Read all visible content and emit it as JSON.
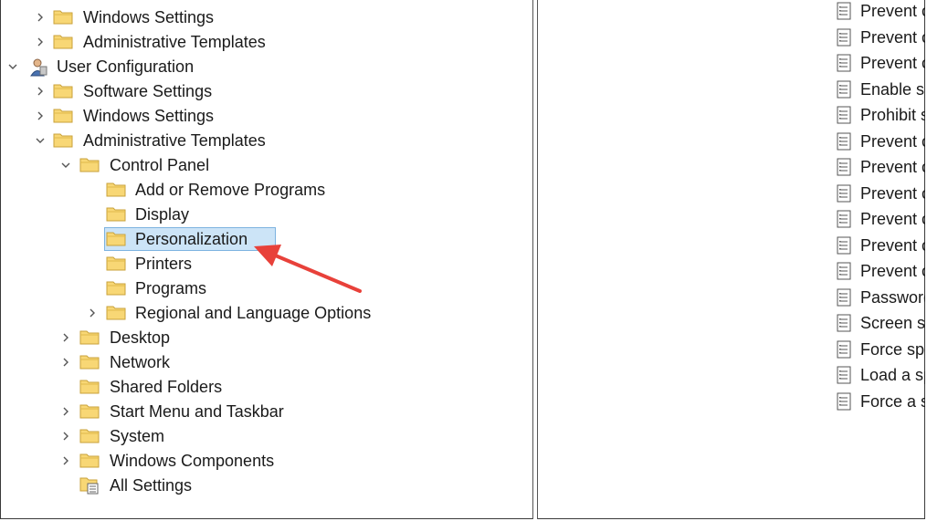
{
  "tree": [
    {
      "label": "Windows Settings",
      "expand": "collapsed",
      "icon": "folder-icon"
    },
    {
      "label": "Administrative Templates",
      "expand": "collapsed",
      "icon": "folder-icon"
    },
    {
      "label": "User Configuration",
      "expand": "expanded",
      "icon": "user-config-icon"
    },
    {
      "label": "Software Settings",
      "expand": "collapsed",
      "icon": "folder-icon"
    },
    {
      "label": "Windows Settings",
      "expand": "collapsed",
      "icon": "folder-icon"
    },
    {
      "label": "Administrative Templates",
      "expand": "expanded",
      "icon": "folder-icon"
    },
    {
      "label": "Control Panel",
      "expand": "expanded",
      "icon": "folder-icon"
    },
    {
      "label": "Add or Remove Programs",
      "expand": "none",
      "icon": "folder-icon"
    },
    {
      "label": "Display",
      "expand": "none",
      "icon": "folder-icon"
    },
    {
      "label": "Personalization",
      "expand": "none",
      "icon": "folder-icon",
      "selected": true
    },
    {
      "label": "Printers",
      "expand": "none",
      "icon": "folder-icon"
    },
    {
      "label": "Programs",
      "expand": "none",
      "icon": "folder-icon"
    },
    {
      "label": "Regional and Language Options",
      "expand": "collapsed",
      "icon": "folder-icon"
    },
    {
      "label": "Desktop",
      "expand": "collapsed",
      "icon": "folder-icon"
    },
    {
      "label": "Network",
      "expand": "collapsed",
      "icon": "folder-icon"
    },
    {
      "label": "Shared Folders",
      "expand": "none",
      "icon": "folder-icon"
    },
    {
      "label": "Start Menu and Taskbar",
      "expand": "collapsed",
      "icon": "folder-icon"
    },
    {
      "label": "System",
      "expand": "collapsed",
      "icon": "folder-icon"
    },
    {
      "label": "Windows Components",
      "expand": "collapsed",
      "icon": "folder-icon"
    },
    {
      "label": "All Settings",
      "expand": "none",
      "icon": "all-settings-icon"
    }
  ],
  "policies": [
    "Prevent c",
    "Prevent c",
    "Prevent c",
    "Enable sc",
    "Prohibit s",
    "Prevent c",
    "Prevent c",
    "Prevent c",
    "Prevent c",
    "Prevent c",
    "Prevent c",
    "Password",
    "Screen sa",
    "Force spe",
    "Load a sp",
    "Force a sp"
  ],
  "colors": {
    "selection_bg": "#cce4f7",
    "selection_border": "#7db3e0",
    "annotation_arrow": "#e8413a",
    "folder_fill": "#f8d775"
  },
  "annotation_icon": "red-arrow-icon"
}
